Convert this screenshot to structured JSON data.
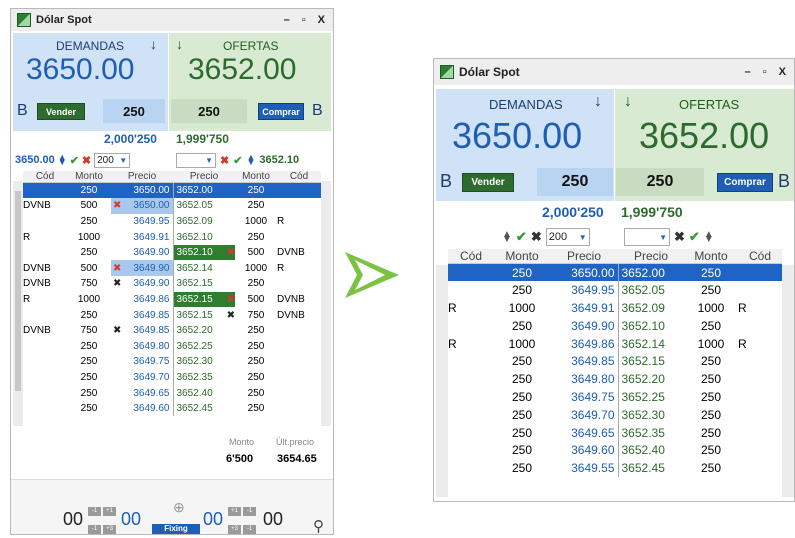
{
  "left": {
    "title": "Dólar Spot",
    "window_buttons": [
      "–",
      "▫",
      "X"
    ],
    "demandas_label": "DEMANDAS",
    "ofertas_label": "OFERTAS",
    "bid": "3650.00",
    "ask": "3652.00",
    "b_left": "B",
    "b_right": "B",
    "vender": "Vender",
    "comprar": "Comprar",
    "qty_bid": "250",
    "qty_ask": "250",
    "total_bid": "2,000'250",
    "total_ask": "1,999'750",
    "ctrl_price": "3650.00",
    "ctrl_qty": "200",
    "ctrl_price_right": "3652.10",
    "headers": [
      "Cód",
      "Monto",
      "Precio",
      "Precio",
      "Monto",
      "Cód"
    ],
    "rows": [
      {
        "cb": "",
        "mb": "250",
        "pb": "3650.00",
        "pa": "3652.00",
        "ma": "250",
        "ca": "",
        "mark_b": "",
        "mark_a": ""
      },
      {
        "cb": "DVNB",
        "mb": "500",
        "pb": "3650.00",
        "pa": "3652.05",
        "ma": "250",
        "ca": "",
        "mark_b": "x",
        "mark_a": ""
      },
      {
        "cb": "",
        "mb": "250",
        "pb": "3649.95",
        "pa": "3652.09",
        "ma": "1000",
        "ca": "R",
        "mark_b": "",
        "mark_a": ""
      },
      {
        "cb": "R",
        "mb": "1000",
        "pb": "3649.91",
        "pa": "3652.10",
        "ma": "250",
        "ca": "",
        "mark_b": "",
        "mark_a": ""
      },
      {
        "cb": "",
        "mb": "250",
        "pb": "3649.90",
        "pa": "3652.10",
        "ma": "500",
        "ca": "DVNB",
        "mark_b": "",
        "mark_a": "x"
      },
      {
        "cb": "DVNB",
        "mb": "500",
        "pb": "3649.90",
        "pa": "3652.14",
        "ma": "1000",
        "ca": "R",
        "mark_b": "x",
        "mark_a": ""
      },
      {
        "cb": "DVNB",
        "mb": "750",
        "pb": "3649.90",
        "pa": "3652.15",
        "ma": "250",
        "ca": "",
        "mark_b": "k",
        "mark_a": ""
      },
      {
        "cb": "R",
        "mb": "1000",
        "pb": "3649.86",
        "pa": "3652.15",
        "ma": "500",
        "ca": "DVNB",
        "mark_b": "",
        "mark_a": "x"
      },
      {
        "cb": "",
        "mb": "250",
        "pb": "3649.85",
        "pa": "3652.15",
        "ma": "750",
        "ca": "DVNB",
        "mark_b": "",
        "mark_a": "k"
      },
      {
        "cb": "DVNB",
        "mb": "750",
        "pb": "3649.85",
        "pa": "3652.20",
        "ma": "250",
        "ca": "",
        "mark_b": "k",
        "mark_a": ""
      },
      {
        "cb": "",
        "mb": "250",
        "pb": "3649.80",
        "pa": "3652.25",
        "ma": "250",
        "ca": "",
        "mark_b": "",
        "mark_a": ""
      },
      {
        "cb": "",
        "mb": "250",
        "pb": "3649.75",
        "pa": "3652.30",
        "ma": "250",
        "ca": "",
        "mark_b": "",
        "mark_a": ""
      },
      {
        "cb": "",
        "mb": "250",
        "pb": "3649.70",
        "pa": "3652.35",
        "ma": "250",
        "ca": "",
        "mark_b": "",
        "mark_a": ""
      },
      {
        "cb": "",
        "mb": "250",
        "pb": "3649.65",
        "pa": "3652.40",
        "ma": "250",
        "ca": "",
        "mark_b": "",
        "mark_a": ""
      },
      {
        "cb": "",
        "mb": "250",
        "pb": "3649.60",
        "pa": "3652.45",
        "ma": "250",
        "ca": "",
        "mark_b": "",
        "mark_a": ""
      }
    ],
    "footer_monto_label": "Monto",
    "footer_ult_label": "Últ.precio",
    "footer_monto": "6'500",
    "footer_ult": "3654.65",
    "bottom_left_val": "00",
    "bottom_mid_left": "00",
    "bottom_mid_right": "00",
    "bottom_right_val": "00",
    "fixing": "Fixing",
    "minis": [
      "-1",
      "+1",
      "-1",
      "+3"
    ]
  },
  "right": {
    "title": "Dólar Spot",
    "window_buttons": [
      "–",
      "▫",
      "X"
    ],
    "demandas_label": "DEMANDAS",
    "ofertas_label": "OFERTAS",
    "bid": "3650.00",
    "ask": "3652.00",
    "b_left": "B",
    "b_right": "B",
    "vender": "Vender",
    "comprar": "Comprar",
    "qty_bid": "250",
    "qty_ask": "250",
    "total_bid": "2,000'250",
    "total_ask": "1,999'750",
    "ctrl_qty": "200",
    "headers": [
      "Cód",
      "Monto",
      "Precio",
      "Precio",
      "Monto",
      "Cód"
    ],
    "rows": [
      {
        "cb": "",
        "mb": "250",
        "pb": "3650.00",
        "pa": "3652.00",
        "ma": "250",
        "ca": ""
      },
      {
        "cb": "",
        "mb": "250",
        "pb": "3649.95",
        "pa": "3652.05",
        "ma": "250",
        "ca": ""
      },
      {
        "cb": "R",
        "mb": "1000",
        "pb": "3649.91",
        "pa": "3652.09",
        "ma": "1000",
        "ca": "R"
      },
      {
        "cb": "",
        "mb": "250",
        "pb": "3649.90",
        "pa": "3652.10",
        "ma": "250",
        "ca": ""
      },
      {
        "cb": "R",
        "mb": "1000",
        "pb": "3649.86",
        "pa": "3652.14",
        "ma": "1000",
        "ca": "R"
      },
      {
        "cb": "",
        "mb": "250",
        "pb": "3649.85",
        "pa": "3652.15",
        "ma": "250",
        "ca": ""
      },
      {
        "cb": "",
        "mb": "250",
        "pb": "3649.80",
        "pa": "3652.20",
        "ma": "250",
        "ca": ""
      },
      {
        "cb": "",
        "mb": "250",
        "pb": "3649.75",
        "pa": "3652.25",
        "ma": "250",
        "ca": ""
      },
      {
        "cb": "",
        "mb": "250",
        "pb": "3649.70",
        "pa": "3652.30",
        "ma": "250",
        "ca": ""
      },
      {
        "cb": "",
        "mb": "250",
        "pb": "3649.65",
        "pa": "3652.35",
        "ma": "250",
        "ca": ""
      },
      {
        "cb": "",
        "mb": "250",
        "pb": "3649.60",
        "pa": "3652.40",
        "ma": "250",
        "ca": ""
      },
      {
        "cb": "",
        "mb": "250",
        "pb": "3649.55",
        "pa": "3652.45",
        "ma": "250",
        "ca": ""
      }
    ]
  },
  "colors": {
    "bid_blue": "#1e5eb4",
    "ask_green": "#2d6a2d",
    "arrow_green": "#7cc242"
  }
}
